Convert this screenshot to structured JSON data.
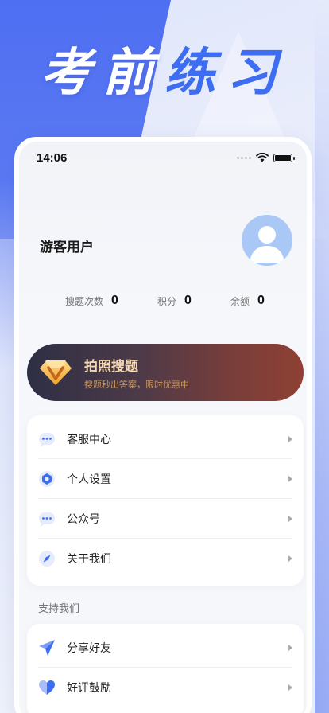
{
  "headline": {
    "part1": "考前",
    "part2": "练习"
  },
  "status_bar": {
    "time": "14:06"
  },
  "profile": {
    "username": "游客用户"
  },
  "stats": [
    {
      "label": "搜题次数",
      "value": "0"
    },
    {
      "label": "积分",
      "value": "0"
    },
    {
      "label": "余额",
      "value": "0"
    }
  ],
  "promo": {
    "title": "拍照搜题",
    "subtitle": "搜题秒出答案，限时优惠中"
  },
  "menu": [
    {
      "label": "客服中心",
      "icon": "chat-icon"
    },
    {
      "label": "个人设置",
      "icon": "settings-icon"
    },
    {
      "label": "公众号",
      "icon": "chat-icon"
    },
    {
      "label": "关于我们",
      "icon": "compass-icon"
    }
  ],
  "support": {
    "heading": "支持我们",
    "items": [
      {
        "label": "分享好友",
        "icon": "share-icon"
      },
      {
        "label": "好评鼓励",
        "icon": "heart-icon"
      }
    ]
  },
  "colors": {
    "accent": "#3d6df0",
    "promo_gold": "#f4d9b0"
  }
}
